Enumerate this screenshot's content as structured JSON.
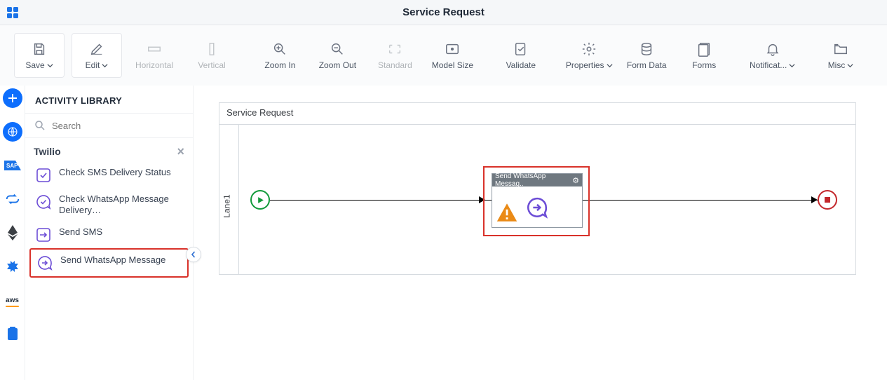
{
  "header": {
    "title": "Service Request"
  },
  "toolbar": {
    "save": "Save",
    "edit": "Edit",
    "horizontal": "Horizontal",
    "vertical": "Vertical",
    "zoom_in": "Zoom In",
    "zoom_out": "Zoom Out",
    "standard": "Standard",
    "model_size": "Model Size",
    "validate": "Validate",
    "properties": "Properties",
    "form_data": "Form Data",
    "forms": "Forms",
    "notifications": "Notificat...",
    "misc": "Misc"
  },
  "sidebar": {
    "title": "ACTIVITY LIBRARY",
    "search_placeholder": "Search",
    "category": "Twilio",
    "items": [
      {
        "label": "Check SMS Delivery Status"
      },
      {
        "label": "Check WhatsApp Message Delivery…"
      },
      {
        "label": "Send SMS"
      },
      {
        "label": "Send WhatsApp Message"
      }
    ]
  },
  "canvas": {
    "process_name": "Service Request",
    "lane_name": "Lane1",
    "node_label": "Send WhatsApp Messag.."
  },
  "icons": {
    "check_icon": "check-square",
    "chat_icon": "chat-bubble",
    "arrow_icon": "arrow-right"
  }
}
